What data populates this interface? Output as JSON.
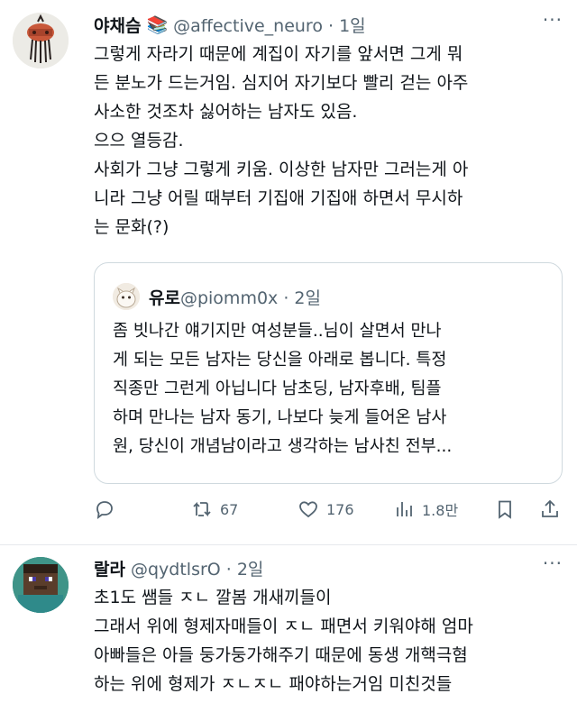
{
  "tweets": [
    {
      "author_name": "야채슴",
      "author_emoji": "📚",
      "handle_time": "@affective_neuro · 1일",
      "more": "···",
      "lines": [
        "그렇게 자라기 때문에 계집이 자기를 앞서면 그게 뭐",
        "든 분노가 드는거임. 심지어 자기보다 빨리 걷는 아주",
        "사소한 것조차 싫어하는 남자도 있음.",
        "으으 열등감.",
        "사회가 그냥 그렇게 키움. 이상한 남자만 그러는게 아",
        "니라 그냥 어릴 때부터 기집애 기집애 하면서 무시하",
        "는 문화(?)"
      ],
      "quote": {
        "author_name": "유로",
        "handle_time": "@piomm0x · 2일",
        "lines": [
          "좀 빗나간 얘기지만 여성분들..님이 살면서 만나",
          "게 되는 모든 남자는 당신을 아래로 봅니다. 특정",
          "직종만 그런게 아닙니다 남초딩, 남자후배, 팀플",
          "하며 만나는 남자 동기, 나보다 늦게 들어온 남사",
          "원, 당신이 개념남이라고 생각하는 남사친 전부..."
        ]
      },
      "actions": {
        "reply_icon": "reply-icon",
        "retweet_count": "67",
        "like_count": "176",
        "views_count": "1.8만"
      }
    },
    {
      "author_name": "랄라",
      "handle_time": "@qydtlsrO · 2일",
      "more": "···",
      "lines": [
        "초1도 쌤들 ㅈㄴ 깔봄 개새끼들이",
        "그래서 위에 형제자매들이 ㅈㄴ 패면서 키워야해 엄마",
        "아빠들은 아들 둥가둥가해주기 때문에 동생 개핵극혐",
        "하는 위에 형제가 ㅈㄴㅈㄴ 패야하는거임 미친것들"
      ]
    }
  ]
}
